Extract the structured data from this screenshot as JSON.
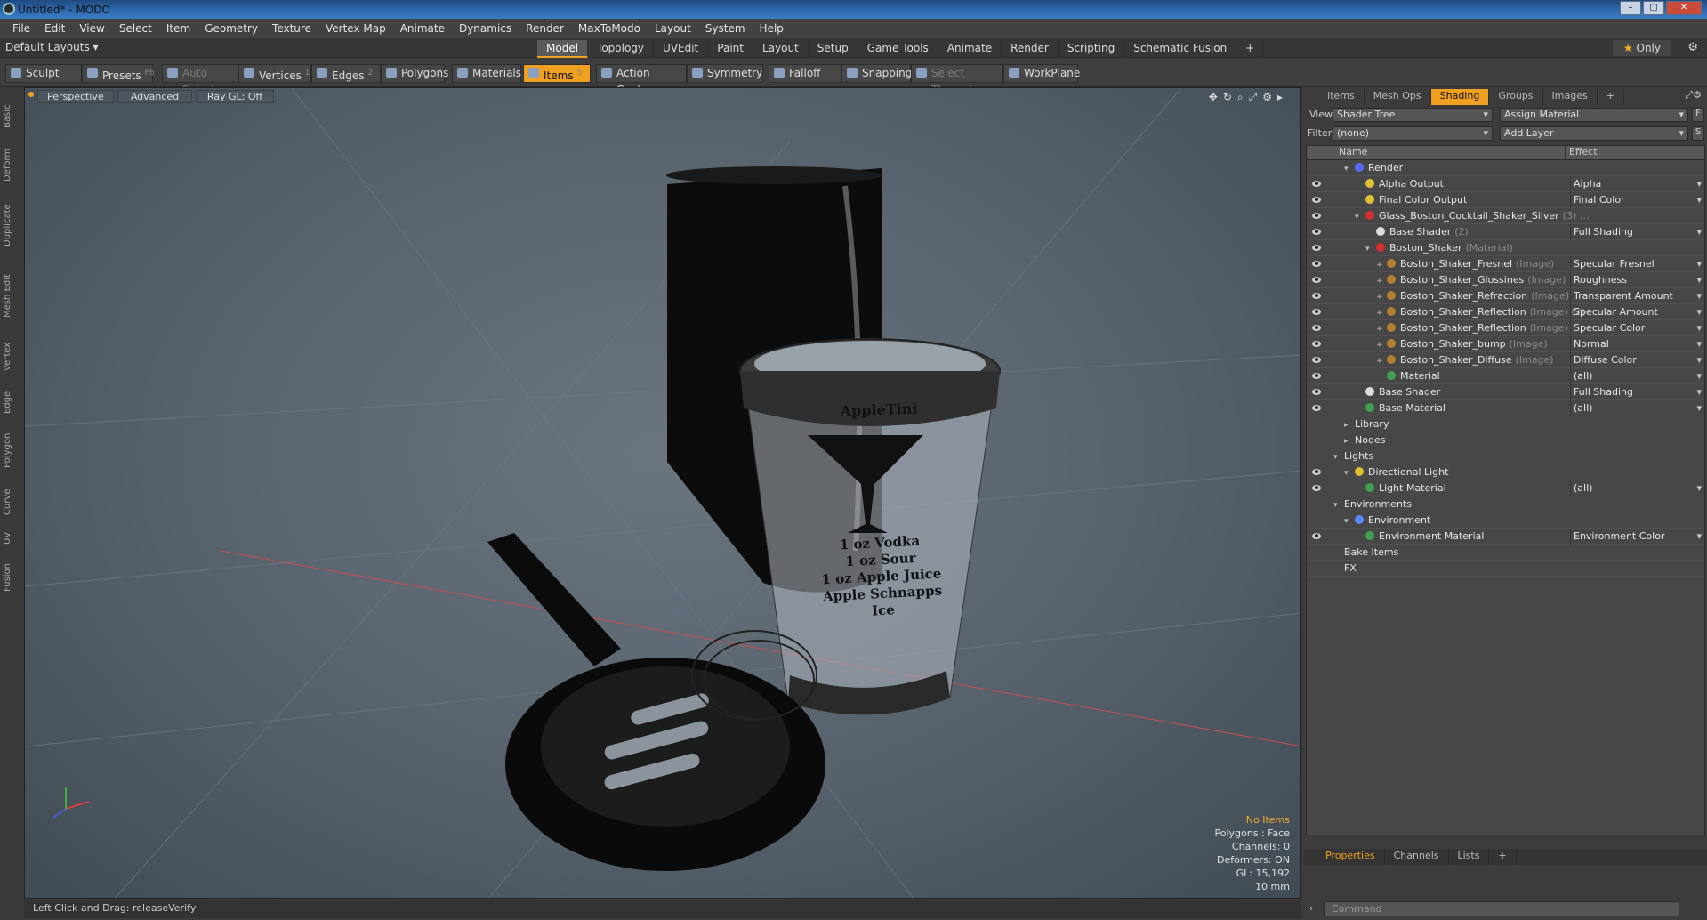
{
  "window": {
    "title": "Untitled* - MODO"
  },
  "menu": [
    "File",
    "Edit",
    "View",
    "Select",
    "Item",
    "Geometry",
    "Texture",
    "Vertex Map",
    "Animate",
    "Dynamics",
    "Render",
    "MaxToModo",
    "Layout",
    "System",
    "Help"
  ],
  "layout": {
    "default_layouts": "Default Layouts ▾",
    "tabs": [
      "Model",
      "Topology",
      "UVEdit",
      "Paint",
      "Layout",
      "Setup",
      "Game Tools",
      "Animate",
      "Render",
      "Scripting",
      "Schematic Fusion",
      "+"
    ],
    "active_tab": "Model",
    "only_label": "Only"
  },
  "toolbar": {
    "sculpt": "Sculpt",
    "presets": "Presets",
    "presets_key": "F6",
    "auto_select": "Auto Select",
    "vertices": "Vertices",
    "vertices_key": "1",
    "edges": "Edges",
    "edges_key": "2",
    "polygons": "Polygons",
    "materials": "Materials",
    "items": "Items",
    "items_key": "5",
    "action_center": "Action Center",
    "symmetry": "Symmetry",
    "falloff": "Falloff",
    "snapping": "Snapping",
    "select_through": "Select Through",
    "workplane": "WorkPlane"
  },
  "left_tabs": [
    "Basic",
    "Deform",
    "Duplicate",
    "Mesh Edit",
    "Vertex",
    "Edge",
    "Polygon",
    "Curve",
    "UV",
    "Fusion"
  ],
  "viewport": {
    "view_mode": "Perspective",
    "advanced": "Advanced",
    "ray_gl": "Ray GL: Off",
    "hud": {
      "selection": "No Items",
      "polygons": "Polygons : Face",
      "channels": "Channels: 0",
      "deformers": "Deformers: ON",
      "gl": "GL: 15,192",
      "scale": "10 mm"
    },
    "label_text": [
      "AppleTini",
      "1 oz Vodka",
      "1 oz Sour",
      "1 oz Apple Juice",
      "Apple Schnapps",
      "Ice"
    ]
  },
  "status": {
    "text": "Left Click and Drag:   releaseVerify"
  },
  "right_panel": {
    "tabs": [
      "Items",
      "Mesh Ops",
      "Shading",
      "Groups",
      "Images",
      "+"
    ],
    "active_tab": "Shading",
    "view_label": "View",
    "view_value": "Shader Tree",
    "assign_material": "Assign Material",
    "filter_label": "Filter",
    "filter_value": "(none)",
    "add_layer": "Add Layer",
    "col_name": "Name",
    "col_effect": "Effect",
    "rows": [
      {
        "indent": 1,
        "tw": "▾",
        "eye": false,
        "dot": "#5a6aff",
        "name": "Render",
        "sub": "",
        "effect": ""
      },
      {
        "indent": 2,
        "tw": "",
        "eye": true,
        "dot": "#e0c030",
        "name": "Alpha Output",
        "sub": "",
        "effect": "Alpha"
      },
      {
        "indent": 2,
        "tw": "",
        "eye": true,
        "dot": "#e0c030",
        "name": "Final Color Output",
        "sub": "",
        "effect": "Final Color"
      },
      {
        "indent": 2,
        "tw": "▾",
        "eye": true,
        "dot": "#d03030",
        "name": "Glass_Boston_Cocktail_Shaker_Silver",
        "sub": "(3) …",
        "effect": ""
      },
      {
        "indent": 3,
        "tw": "",
        "eye": true,
        "dot": "#dddddd",
        "name": "Base Shader",
        "sub": "(2)",
        "effect": "Full Shading"
      },
      {
        "indent": 3,
        "tw": "▾",
        "eye": true,
        "dot": "#d03030",
        "name": "Boston_Shaker",
        "sub": "(Material)",
        "effect": ""
      },
      {
        "indent": 4,
        "tw": "+",
        "eye": true,
        "dot": "#b08030",
        "name": "Boston_Shaker_Fresnel",
        "sub": "(Image)",
        "effect": "Specular Fresnel"
      },
      {
        "indent": 4,
        "tw": "+",
        "eye": true,
        "dot": "#b08030",
        "name": "Boston_Shaker_Glossines",
        "sub": "(Image)",
        "effect": "Roughness"
      },
      {
        "indent": 4,
        "tw": "+",
        "eye": true,
        "dot": "#b08030",
        "name": "Boston_Shaker_Refraction",
        "sub": "(Image)",
        "effect": "Transparent Amount"
      },
      {
        "indent": 4,
        "tw": "+",
        "eye": true,
        "dot": "#b08030",
        "name": "Boston_Shaker_Reflection",
        "sub": "(Image) (2)",
        "effect": "Specular Amount"
      },
      {
        "indent": 4,
        "tw": "+",
        "eye": true,
        "dot": "#b08030",
        "name": "Boston_Shaker_Reflection",
        "sub": "(Image)",
        "effect": "Specular Color"
      },
      {
        "indent": 4,
        "tw": "+",
        "eye": true,
        "dot": "#b08030",
        "name": "Boston_Shaker_bump",
        "sub": "(Image)",
        "effect": "Normal"
      },
      {
        "indent": 4,
        "tw": "+",
        "eye": true,
        "dot": "#b08030",
        "name": "Boston_Shaker_Diffuse",
        "sub": "(Image)",
        "effect": "Diffuse Color"
      },
      {
        "indent": 4,
        "tw": "",
        "eye": true,
        "dot": "#40a050",
        "name": "Material",
        "sub": "",
        "effect": "(all)"
      },
      {
        "indent": 2,
        "tw": "",
        "eye": true,
        "dot": "#dddddd",
        "name": "Base Shader",
        "sub": "",
        "effect": "Full Shading"
      },
      {
        "indent": 2,
        "tw": "",
        "eye": true,
        "dot": "#40a050",
        "name": "Base Material",
        "sub": "",
        "effect": "(all)"
      },
      {
        "indent": 1,
        "tw": "▸",
        "eye": false,
        "dot": "",
        "name": "Library",
        "sub": "",
        "effect": ""
      },
      {
        "indent": 1,
        "tw": "▸",
        "eye": false,
        "dot": "",
        "name": "Nodes",
        "sub": "",
        "effect": ""
      },
      {
        "indent": 0,
        "tw": "▾",
        "eye": false,
        "dot": "",
        "name": "Lights",
        "sub": "",
        "effect": ""
      },
      {
        "indent": 1,
        "tw": "▾",
        "eye": true,
        "dot": "#e0c030",
        "name": "Directional Light",
        "sub": "",
        "effect": ""
      },
      {
        "indent": 2,
        "tw": "",
        "eye": true,
        "dot": "#40a050",
        "name": "Light Material",
        "sub": "",
        "effect": "(all)"
      },
      {
        "indent": 0,
        "tw": "▾",
        "eye": false,
        "dot": "",
        "name": "Environments",
        "sub": "",
        "effect": ""
      },
      {
        "indent": 1,
        "tw": "▾",
        "eye": false,
        "dot": "#5a8aff",
        "name": "Environment",
        "sub": "",
        "effect": ""
      },
      {
        "indent": 2,
        "tw": "",
        "eye": true,
        "dot": "#40a050",
        "name": "Environment Material",
        "sub": "",
        "effect": "Environment Color"
      },
      {
        "indent": 0,
        "tw": "",
        "eye": false,
        "dot": "",
        "name": "Bake Items",
        "sub": "",
        "effect": ""
      },
      {
        "indent": 0,
        "tw": "",
        "eye": false,
        "dot": "",
        "name": "FX",
        "sub": "",
        "effect": ""
      }
    ],
    "bottom_tabs": [
      "Properties",
      "Channels",
      "Lists",
      "+"
    ],
    "bottom_active": "Properties",
    "command_placeholder": "Command"
  }
}
